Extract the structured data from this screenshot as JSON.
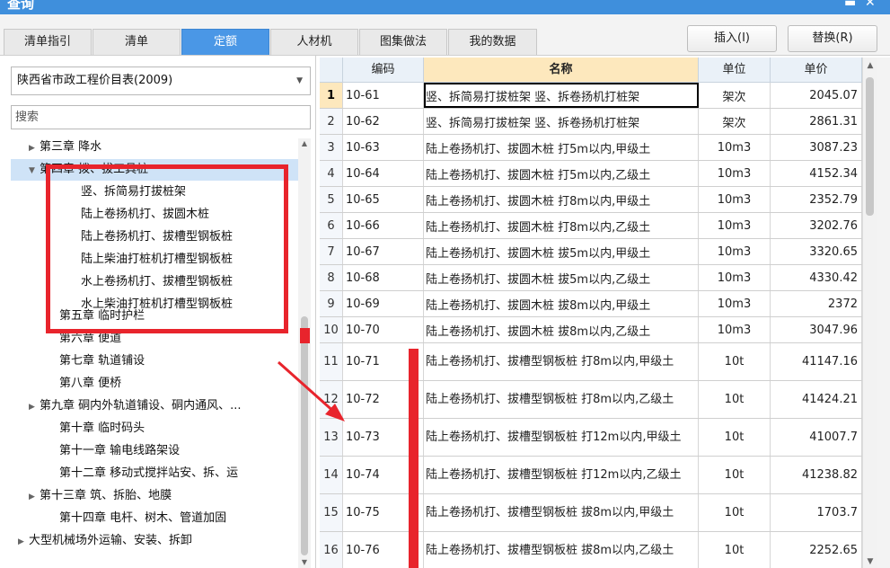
{
  "window": {
    "title": "查询",
    "minimize": "▬",
    "close": "✕"
  },
  "tabs": [
    {
      "label": "清单指引",
      "active": false
    },
    {
      "label": "清单",
      "active": false
    },
    {
      "label": "定额",
      "active": true
    },
    {
      "label": "人材机",
      "active": false
    },
    {
      "label": "图集做法",
      "active": false
    },
    {
      "label": "我的数据",
      "active": false
    }
  ],
  "actions": {
    "insert": "插入(I)",
    "replace": "替换(R)"
  },
  "left": {
    "catalog": "陕西省市政工程价目表(2009)",
    "search_placeholder": "搜索",
    "tree": [
      {
        "label": "第三章 降水",
        "toggle": "▶"
      },
      {
        "label": "第四章 拨、拔工具桩",
        "toggle": "▼"
      },
      {
        "label": "竖、拆简易打拔桩架",
        "toggle": ""
      },
      {
        "label": "陆上卷扬机打、拔圆木桩",
        "toggle": ""
      },
      {
        "label": "陆上卷扬机打、拔槽型钢板桩",
        "toggle": ""
      },
      {
        "label": "陆上柴油打桩机打槽型钢板桩",
        "toggle": ""
      },
      {
        "label": "水上卷扬机打、拔槽型钢板桩",
        "toggle": ""
      },
      {
        "label": "水上柴油打桩机打槽型钢板桩",
        "toggle": ""
      },
      {
        "label": "第五章 临时护栏",
        "toggle": ""
      },
      {
        "label": "第六章 便道",
        "toggle": ""
      },
      {
        "label": "第七章 轨道铺设",
        "toggle": ""
      },
      {
        "label": "第八章 便桥",
        "toggle": ""
      },
      {
        "label": "第九章 硐内外轨道铺设、硐内通风、...",
        "toggle": "▶"
      },
      {
        "label": "第十章 临时码头",
        "toggle": ""
      },
      {
        "label": "第十一章 输电线路架设",
        "toggle": ""
      },
      {
        "label": "第十二章 移动式搅拌站安、拆、运",
        "toggle": ""
      },
      {
        "label": "第十三章 筑、拆胎、地膜",
        "toggle": "▶"
      },
      {
        "label": "第十四章 电杆、树木、管道加固",
        "toggle": ""
      },
      {
        "label": "大型机械场外运输、安装、拆卸",
        "toggle": "▶"
      }
    ]
  },
  "grid": {
    "headers": {
      "code": "编码",
      "name": "名称",
      "unit": "单位",
      "price": "单价"
    },
    "rows": [
      {
        "idx": "1",
        "code": "10-61",
        "name": "竖、拆简易打拔桩架 竖、拆卷扬机打桩架",
        "unit": "架次",
        "price": "2045.07"
      },
      {
        "idx": "2",
        "code": "10-62",
        "name": "竖、拆简易打拔桩架 竖、拆卷扬机打桩架",
        "unit": "架次",
        "price": "2861.31"
      },
      {
        "idx": "3",
        "code": "10-63",
        "name": "陆上卷扬机打、拔圆木桩 打5m以内,甲级土",
        "unit": "10m3",
        "price": "3087.23"
      },
      {
        "idx": "4",
        "code": "10-64",
        "name": "陆上卷扬机打、拔圆木桩 打5m以内,乙级土",
        "unit": "10m3",
        "price": "4152.34"
      },
      {
        "idx": "5",
        "code": "10-65",
        "name": "陆上卷扬机打、拔圆木桩 打8m以内,甲级土",
        "unit": "10m3",
        "price": "2352.79"
      },
      {
        "idx": "6",
        "code": "10-66",
        "name": "陆上卷扬机打、拔圆木桩 打8m以内,乙级土",
        "unit": "10m3",
        "price": "3202.76"
      },
      {
        "idx": "7",
        "code": "10-67",
        "name": "陆上卷扬机打、拔圆木桩 拔5m以内,甲级土",
        "unit": "10m3",
        "price": "3320.65"
      },
      {
        "idx": "8",
        "code": "10-68",
        "name": "陆上卷扬机打、拔圆木桩 拔5m以内,乙级土",
        "unit": "10m3",
        "price": "4330.42"
      },
      {
        "idx": "9",
        "code": "10-69",
        "name": "陆上卷扬机打、拔圆木桩 拔8m以内,甲级土",
        "unit": "10m3",
        "price": "2372"
      },
      {
        "idx": "10",
        "code": "10-70",
        "name": "陆上卷扬机打、拔圆木桩 拔8m以内,乙级土",
        "unit": "10m3",
        "price": "3047.96"
      },
      {
        "idx": "11",
        "code": "10-71",
        "name": "陆上卷扬机打、拔槽型钢板桩 打8m以内,甲级土",
        "unit": "10t",
        "price": "41147.16"
      },
      {
        "idx": "12",
        "code": "10-72",
        "name": "陆上卷扬机打、拔槽型钢板桩 打8m以内,乙级土",
        "unit": "10t",
        "price": "41424.21"
      },
      {
        "idx": "13",
        "code": "10-73",
        "name": "陆上卷扬机打、拔槽型钢板桩 打12m以内,甲级土",
        "unit": "10t",
        "price": "41007.7"
      },
      {
        "idx": "14",
        "code": "10-74",
        "name": "陆上卷扬机打、拔槽型钢板桩 打12m以内,乙级土",
        "unit": "10t",
        "price": "41238.82"
      },
      {
        "idx": "15",
        "code": "10-75",
        "name": "陆上卷扬机打、拔槽型钢板桩 拔8m以内,甲级土",
        "unit": "10t",
        "price": "1703.7"
      },
      {
        "idx": "16",
        "code": "10-76",
        "name": "陆上卷扬机打、拔槽型钢板桩 拔8m以内,乙级土",
        "unit": "10t",
        "price": "2252.65"
      }
    ]
  },
  "icons": {
    "scroll_up": "▲",
    "scroll_down": "▼",
    "combo_arrow": "▼"
  },
  "colors": {
    "active_tab": "#4a97e6",
    "selection": "#cfe3f7",
    "sort_header": "#fde8bd",
    "annotation": "#e8242c"
  }
}
